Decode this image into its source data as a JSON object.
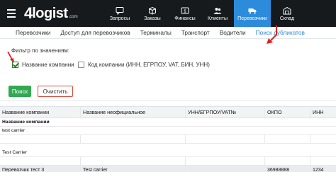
{
  "app": {
    "logo_num": "4",
    "logo_word": "logist",
    "logo_domain": ".com"
  },
  "nav": [
    {
      "label": "Запросы",
      "icon": "chat-icon"
    },
    {
      "label": "Заказы",
      "icon": "box-icon"
    },
    {
      "label": "Финансы",
      "icon": "money-icon"
    },
    {
      "label": "Клиенты",
      "icon": "users-icon"
    },
    {
      "label": "Перевозчики",
      "icon": "truck-icon",
      "active": true
    },
    {
      "label": "Склад",
      "icon": "warehouse-icon"
    }
  ],
  "subnav": [
    {
      "label": "Перевозчики"
    },
    {
      "label": "Доступ для перевозчиков"
    },
    {
      "label": "Терминалы"
    },
    {
      "label": "Транспорт"
    },
    {
      "label": "Водители"
    },
    {
      "label": "Поиск дубликатов",
      "active": true
    }
  ],
  "filter": {
    "title": "Фильтр по значениям:",
    "option1": {
      "label": "Название компании",
      "checked": true
    },
    "option2": {
      "label": "Код компании (ИНН, ЕГРПОУ, VAT, БИН, УНН)",
      "checked": false
    }
  },
  "buttons": {
    "search": "Поиск",
    "clear": "Очистить"
  },
  "table": {
    "headers": [
      "Название компании",
      "Название неофициальное",
      "УНН/ЕГРПОУ/VAT№",
      "ОКПО",
      "ИНН"
    ],
    "group_label": "Название компании",
    "group_values": [
      "test carrier",
      "Test Carrier"
    ],
    "rows": [
      [
        "Перевозчик тест 3",
        "Test carrier",
        "",
        "36988888",
        "1234"
      ]
    ]
  },
  "colors": {
    "topbar": "#161a1d",
    "accent": "#2d8bdb",
    "search_button": "#33a852",
    "clear_border": "#d6493b",
    "annotation_arrow": "#e0211f"
  }
}
